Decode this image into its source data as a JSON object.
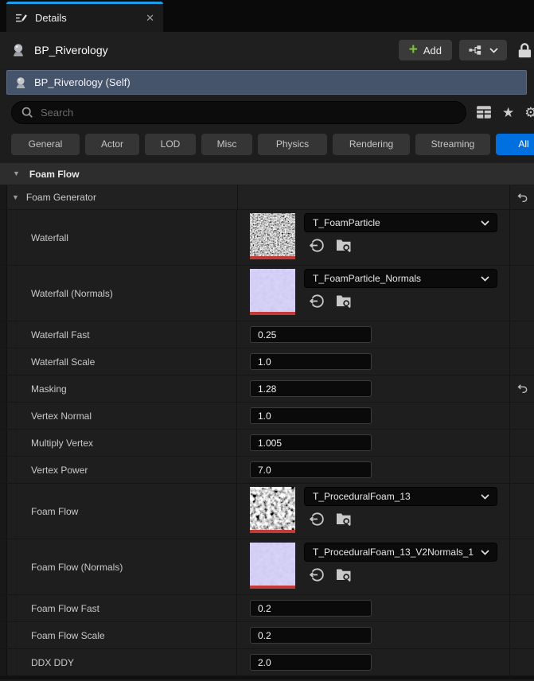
{
  "window": {
    "tab_title": "Details",
    "close_glyph": "✕"
  },
  "header": {
    "object_name": "BP_Riverology",
    "add_button_label": "Add",
    "add_plus_glyph": "+"
  },
  "self_row": {
    "label": "BP_Riverology (Self)"
  },
  "search": {
    "placeholder": "Search"
  },
  "filter_tabs": {
    "items": [
      "General",
      "Actor",
      "LOD",
      "Misc",
      "Physics",
      "Rendering",
      "Streaming",
      "All"
    ],
    "active": "All"
  },
  "category": {
    "label": "Foam Flow",
    "expanded_glyph": "▼"
  },
  "group": {
    "label": "Foam Generator",
    "expanded_glyph": "▼",
    "has_reset": true
  },
  "properties": [
    {
      "kind": "texture",
      "label": "Waterfall",
      "asset": "T_FoamParticle",
      "thumb": "grayscale-foam-fine",
      "has_reset": false
    },
    {
      "kind": "texture",
      "label": "Waterfall (Normals)",
      "asset": "T_FoamParticle_Normals",
      "thumb": "purple-normal-map",
      "has_reset": false
    },
    {
      "kind": "number",
      "label": "Waterfall Fast",
      "value": "0.25",
      "has_reset": false
    },
    {
      "kind": "number",
      "label": "Waterfall Scale",
      "value": "1.0",
      "has_reset": false
    },
    {
      "kind": "number",
      "label": "Masking",
      "value": "1.28",
      "has_reset": true
    },
    {
      "kind": "number",
      "label": "Vertex Normal",
      "value": "1.0",
      "has_reset": false
    },
    {
      "kind": "number",
      "label": "Multiply Vertex",
      "value": "1.005",
      "has_reset": false
    },
    {
      "kind": "number",
      "label": "Vertex Power",
      "value": "7.0",
      "has_reset": false
    },
    {
      "kind": "texture",
      "label": "Foam Flow",
      "asset": "T_ProceduralFoam_13",
      "thumb": "grayscale-foam-blobs",
      "has_reset": false
    },
    {
      "kind": "texture",
      "label": "Foam Flow (Normals)",
      "asset": "T_ProceduralFoam_13_V2Normals_1",
      "thumb": "purple-normal-map",
      "has_reset": false
    },
    {
      "kind": "number",
      "label": "Foam Flow Fast",
      "value": "0.2",
      "has_reset": false
    },
    {
      "kind": "number",
      "label": "Foam Flow Scale",
      "value": "0.2",
      "has_reset": false
    },
    {
      "kind": "number",
      "label": "DDX DDY",
      "value": "2.0",
      "has_reset": false
    }
  ],
  "icons": {
    "star_glyph": "★",
    "gear_glyph": "⚙",
    "names": [
      "details-icon",
      "close-icon",
      "actor-icon",
      "add-plus-icon",
      "subobjects-icon",
      "chevron-down-icon",
      "lock-icon",
      "search-icon",
      "property-matrix-icon",
      "favorites-star-icon",
      "settings-gear-icon",
      "expander-arrow-icon",
      "use-selected-asset-icon",
      "browse-to-asset-icon",
      "reset-to-default-icon"
    ]
  },
  "colors": {
    "tab_accent_blue": "#1e9ee8",
    "active_filter_blue": "#0070e0",
    "selection_bg": "#45536b",
    "selection_border": "#5c6b84",
    "add_plus_green": "#7cc03c",
    "thumb_underline_red": "#c43a36",
    "normal_map_lavender": "#c9c3f3"
  }
}
